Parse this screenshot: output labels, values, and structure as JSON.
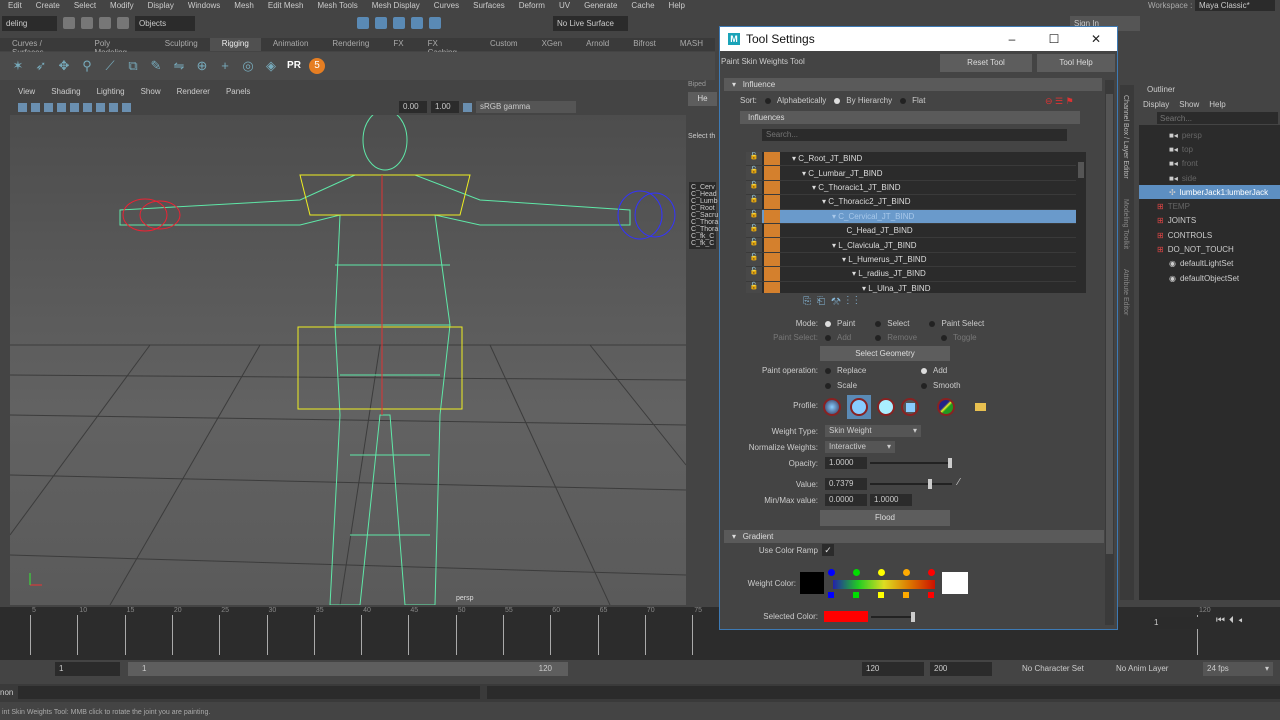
{
  "menu": [
    "Edit",
    "Create",
    "Select",
    "Modify",
    "Display",
    "Windows",
    "Mesh",
    "Edit Mesh",
    "Mesh Tools",
    "Mesh Display",
    "Curves",
    "Surfaces",
    "Deform",
    "UV",
    "Generate",
    "Cache",
    "Help"
  ],
  "status": {
    "mode": "deling",
    "selection_mask": "Objects",
    "live_surface": "No Live Surface",
    "workspace_label": "Workspace :",
    "workspace": "Maya Classic*",
    "sign_in": "Sign In"
  },
  "shelf_tabs": [
    "Curves / Surfaces",
    "Poly Modeling",
    "Sculpting",
    "Rigging",
    "Animation",
    "Rendering",
    "FX",
    "FX Caching",
    "Custom",
    "XGen",
    "Arnold",
    "Bifrost",
    "MASH"
  ],
  "shelf_active": "Rigging",
  "viewport": {
    "menu": [
      "View",
      "Shading",
      "Lighting",
      "Show",
      "Renderer",
      "Panels"
    ],
    "exposure": "0.00",
    "gamma": "1.00",
    "color_space": "sRGB gamma",
    "camera": "persp"
  },
  "mid_panel": {
    "header": "Biped",
    "btn": "He",
    "text": "Select th",
    "items": [
      "C_Cerv",
      "C_Head",
      "C_Lumb",
      "C_Root",
      "C_Sacru",
      "C_Thora",
      "C_Thora",
      "C_fk_C",
      "C_fk_C"
    ]
  },
  "tool_settings": {
    "title": "Tool Settings",
    "tool_name": "Paint Skin Weights Tool",
    "reset": "Reset Tool",
    "help": "Tool Help",
    "influence_section": "Influence",
    "sort_label": "Sort:",
    "sort_options": [
      "Alphabetically",
      "By Hierarchy",
      "Flat"
    ],
    "sort_selected": 1,
    "influences_header": "Influences",
    "search_placeholder": "Search...",
    "joints": [
      {
        "name": "C_Root_JT_BIND",
        "depth": 0
      },
      {
        "name": "C_Lumbar_JT_BIND",
        "depth": 1
      },
      {
        "name": "C_Thoracic1_JT_BIND",
        "depth": 2
      },
      {
        "name": "C_Thoracic2_JT_BIND",
        "depth": 3
      },
      {
        "name": "C_Cervical_JT_BIND",
        "depth": 4,
        "selected": true
      },
      {
        "name": "C_Head_JT_BIND",
        "depth": 5,
        "leaf": true
      },
      {
        "name": "L_Clavicula_JT_BIND",
        "depth": 4
      },
      {
        "name": "L_Humerus_JT_BIND",
        "depth": 5
      },
      {
        "name": "L_radius_JT_BIND",
        "depth": 6
      },
      {
        "name": "L_Ulna_JT_BIND",
        "depth": 7
      }
    ],
    "mode_label": "Mode:",
    "modes": [
      "Paint",
      "Select",
      "Paint Select"
    ],
    "paint_select_label": "Paint Select:",
    "paint_select": [
      "Add",
      "Remove",
      "Toggle"
    ],
    "select_geometry": "Select Geometry",
    "paint_op_label": "Paint operation:",
    "paint_ops": [
      "Replace",
      "Add",
      "Scale",
      "Smooth"
    ],
    "paint_op_selected": "Add",
    "profile_label": "Profile:",
    "weight_type_label": "Weight Type:",
    "weight_type": "Skin Weight",
    "normalize_label": "Normalize Weights:",
    "normalize": "Interactive",
    "opacity_label": "Opacity:",
    "opacity": "1.0000",
    "opacity_fraction": 1.0,
    "value_label": "Value:",
    "value": "0.7379",
    "value_fraction": 0.7379,
    "minmax_label": "Min/Max value:",
    "min": "0.0000",
    "max": "1.0000",
    "flood": "Flood",
    "gradient_section": "Gradient",
    "use_ramp_label": "Use Color Ramp",
    "use_ramp_check": "✓",
    "weight_color_label": "Weight Color:",
    "selected_color_label": "Selected Color:",
    "colors": {
      "selected": "#ff0000",
      "ramp": [
        "#0000ff",
        "#00dd00",
        "#ffff00",
        "#ffaa00",
        "#ff0000"
      ]
    }
  },
  "outliner": {
    "title": "Outliner",
    "menu": [
      "Display",
      "Show",
      "Help"
    ],
    "search_placeholder": "Search...",
    "items": [
      {
        "label": "persp",
        "type": "camera",
        "dim": true
      },
      {
        "label": "top",
        "type": "camera",
        "dim": true
      },
      {
        "label": "front",
        "type": "camera",
        "dim": true
      },
      {
        "label": "side",
        "type": "camera",
        "dim": true
      },
      {
        "label": "lumberJack1:lumberJack",
        "type": "transform",
        "selected": true
      },
      {
        "label": "TEMP",
        "type": "layer",
        "dim": true
      },
      {
        "label": "JOINTS",
        "type": "layer"
      },
      {
        "label": "CONTROLS",
        "type": "layer"
      },
      {
        "label": "DO_NOT_TOUCH",
        "type": "layer"
      },
      {
        "label": "defaultLightSet",
        "type": "set"
      },
      {
        "label": "defaultObjectSet",
        "type": "set"
      }
    ]
  },
  "side_tabs": [
    "Channel Box / Layer Editor",
    "Modeling Toolkit",
    "Attribute Editor"
  ],
  "timeline": {
    "ticks": [
      "5",
      "10",
      "15",
      "20",
      "25",
      "30",
      "35",
      "40",
      "45",
      "50",
      "55",
      "60",
      "65",
      "70",
      "75",
      "120"
    ],
    "current_frame": "1"
  },
  "range": {
    "start": "1",
    "inner_start": "1",
    "inner_end": "120",
    "end": "120",
    "max": "200",
    "character_set": "No Character Set",
    "anim_layer": "No Anim Layer",
    "fps": "24 fps"
  },
  "cmd_label": "non",
  "help_line": "int Skin Weights Tool: MMB click to rotate the joint you are painting."
}
